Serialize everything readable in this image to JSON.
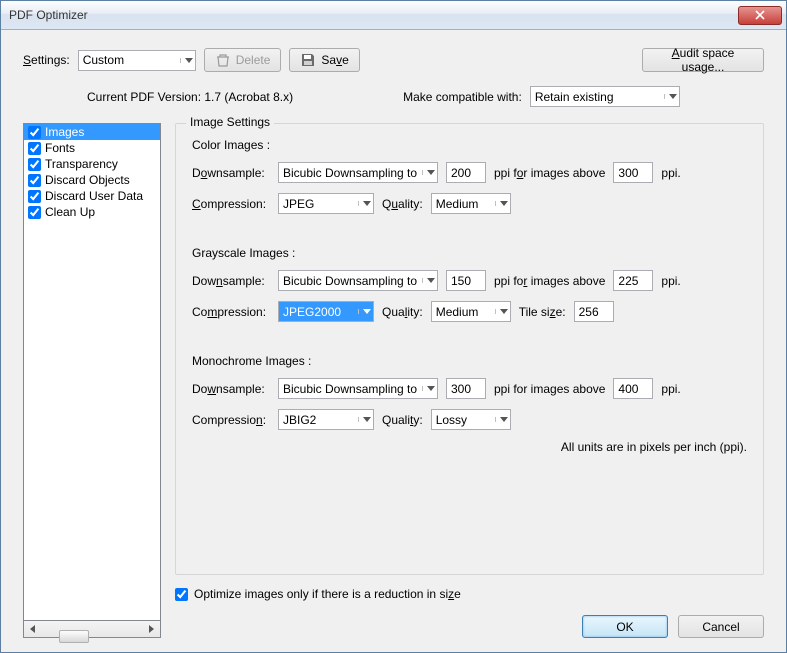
{
  "window": {
    "title": "PDF Optimizer"
  },
  "toolbar": {
    "settings_label": "Settings:",
    "settings_value": "Custom",
    "delete_label": "Delete",
    "save_label": "Save",
    "audit_label": "Audit space usage..."
  },
  "version": {
    "current_label": "Current PDF Version: 1.7 (Acrobat 8.x)",
    "compat_label": "Make compatible with:",
    "compat_value": "Retain existing"
  },
  "categories": [
    {
      "label": "Images",
      "checked": true,
      "selected": true
    },
    {
      "label": "Fonts",
      "checked": true,
      "selected": false
    },
    {
      "label": "Transparency",
      "checked": true,
      "selected": false
    },
    {
      "label": "Discard Objects",
      "checked": true,
      "selected": false
    },
    {
      "label": "Discard User Data",
      "checked": true,
      "selected": false
    },
    {
      "label": "Clean Up",
      "checked": true,
      "selected": false
    }
  ],
  "panel": {
    "legend": "Image Settings",
    "color": {
      "title": "Color Images :",
      "downsample_label": "Downsample:",
      "downsample_value": "Bicubic Downsampling to",
      "ppi_value": "200",
      "ppi_above_label": "ppi for images above",
      "ppi_above_value": "300",
      "ppi_suffix": "ppi.",
      "compression_label": "Compression:",
      "compression_value": "JPEG",
      "quality_label": "Quality:",
      "quality_value": "Medium"
    },
    "gray": {
      "title": "Grayscale Images :",
      "downsample_label": "Downsample:",
      "downsample_value": "Bicubic Downsampling to",
      "ppi_value": "150",
      "ppi_above_label": "ppi for images above",
      "ppi_above_value": "225",
      "ppi_suffix": "ppi.",
      "compression_label": "Compression:",
      "compression_value": "JPEG2000",
      "quality_label": "Quality:",
      "quality_value": "Medium",
      "tile_label": "Tile size:",
      "tile_value": "256"
    },
    "mono": {
      "title": "Monochrome Images :",
      "downsample_label": "Downsample:",
      "downsample_value": "Bicubic Downsampling to",
      "ppi_value": "300",
      "ppi_above_label": "ppi for images above",
      "ppi_above_value": "400",
      "ppi_suffix": "ppi.",
      "compression_label": "Compression:",
      "compression_value": "JBIG2",
      "quality_label": "Quality:",
      "quality_value": "Lossy"
    },
    "footnote": "All units are in pixels per inch (ppi)."
  },
  "optimize": {
    "label": "Optimize images only if there is a reduction in size",
    "checked": true
  },
  "buttons": {
    "ok": "OK",
    "cancel": "Cancel"
  }
}
